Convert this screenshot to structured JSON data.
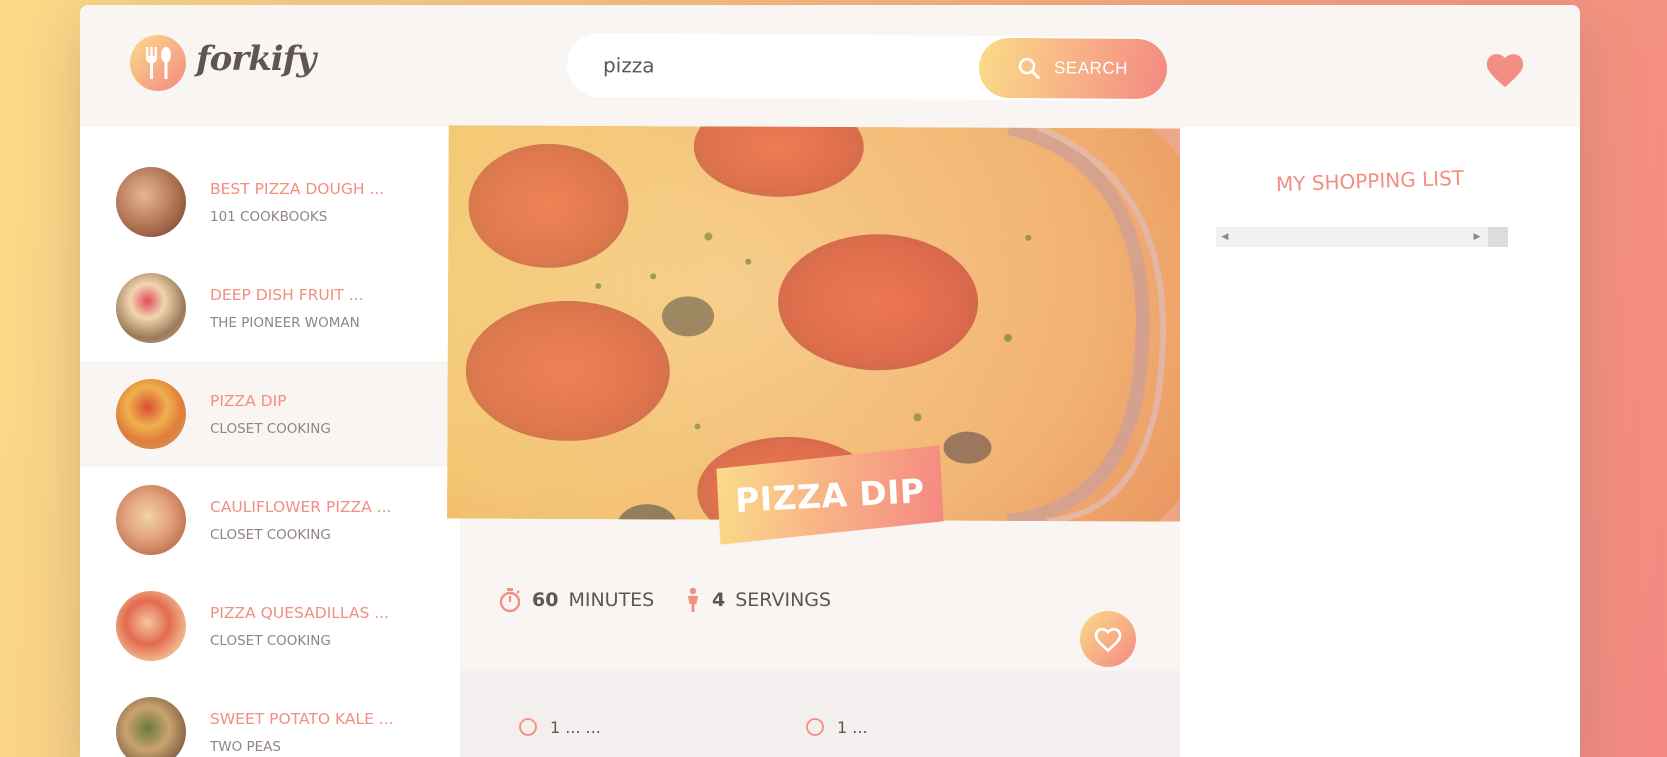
{
  "app": {
    "logo_text": "forkify"
  },
  "search": {
    "value": "pizza",
    "button_label": "SEARCH"
  },
  "results": [
    {
      "title": "BEST PIZZA DOUGH ...",
      "publisher": "101 COOKBOOKS",
      "active": false
    },
    {
      "title": "DEEP DISH FRUIT ...",
      "publisher": "THE PIONEER WOMAN",
      "active": false
    },
    {
      "title": "PIZZA DIP",
      "publisher": "CLOSET COOKING",
      "active": true
    },
    {
      "title": "CAULIFLOWER PIZZA ...",
      "publisher": "CLOSET COOKING",
      "active": false
    },
    {
      "title": "PIZZA QUESADILLAS ...",
      "publisher": "CLOSET COOKING",
      "active": false
    },
    {
      "title": "SWEET POTATO KALE ...",
      "publisher": "TWO PEAS",
      "active": false
    }
  ],
  "recipe": {
    "title": "PIZZA DIP",
    "minutes_value": "60",
    "minutes_label": "MINUTES",
    "servings_value": "4",
    "servings_label": "SERVINGS"
  },
  "ingredients": [
    {
      "text": "1 ... ..."
    },
    {
      "text": "1 ..."
    }
  ],
  "shopping": {
    "title": "MY SHOPPING LIST"
  },
  "colors": {
    "primary": "#f38e82",
    "grad_start": "#fbdb89",
    "grad_end": "#f48982",
    "text": "#615551"
  }
}
